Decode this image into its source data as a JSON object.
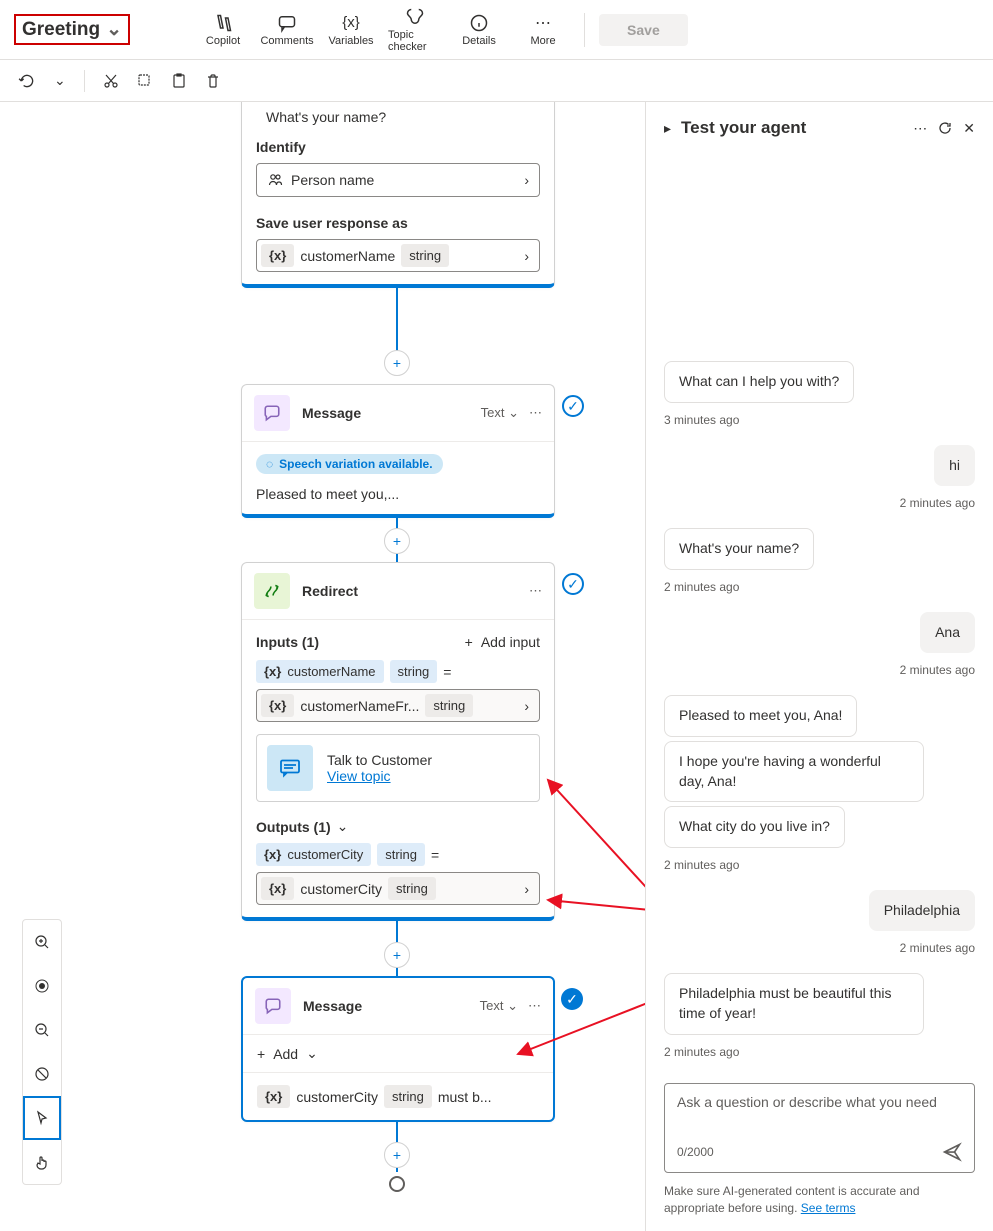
{
  "header": {
    "topic_title": "Greeting",
    "actions": [
      {
        "name": "copilot",
        "label": "Copilot"
      },
      {
        "name": "comments",
        "label": "Comments"
      },
      {
        "name": "variables",
        "label": "Variables"
      },
      {
        "name": "topic-checker",
        "label": "Topic checker"
      },
      {
        "name": "details",
        "label": "Details"
      },
      {
        "name": "more",
        "label": "More"
      }
    ],
    "save_label": "Save"
  },
  "canvas": {
    "card1": {
      "question_text": "What's your name?",
      "identify_label": "Identify",
      "identify_value": "Person name",
      "save_as_label": "Save user response as",
      "var_name": "customerName",
      "var_type": "string"
    },
    "card2": {
      "title": "Message",
      "type_label": "Text",
      "speech_pill": "Speech variation available.",
      "body_text": "Pleased to meet you,..."
    },
    "card3": {
      "title": "Redirect",
      "inputs_label": "Inputs (1)",
      "add_input_label": "Add input",
      "input_var": "customerName",
      "input_type": "string",
      "input_eq": "=",
      "input_val_var": "customerNameFr...",
      "input_val_type": "string",
      "talk_title": "Talk to Customer",
      "view_topic": "View topic",
      "outputs_label": "Outputs (1)",
      "output_var": "customerCity",
      "output_type": "string",
      "output_eq": "=",
      "output_val_var": "customerCity",
      "output_val_type": "string"
    },
    "card4": {
      "title": "Message",
      "type_label": "Text",
      "add_label": "Add",
      "var": "customerCity",
      "var_type": "string",
      "suffix": "must b..."
    }
  },
  "test_panel": {
    "title": "Test your agent",
    "messages": [
      {
        "role": "bot",
        "text": "What can I help you with?",
        "ts": "3 minutes ago"
      },
      {
        "role": "user",
        "text": "hi",
        "ts": "2 minutes ago"
      },
      {
        "role": "bot",
        "text": "What's your name?",
        "ts": "2 minutes ago"
      },
      {
        "role": "user",
        "text": "Ana",
        "ts": "2 minutes ago"
      },
      {
        "role": "bot",
        "text": "Pleased to meet you, Ana!",
        "ts": ""
      },
      {
        "role": "bot",
        "text": "I hope you're having a wonderful day, Ana!",
        "ts": ""
      },
      {
        "role": "bot",
        "text": "What city do you live in?",
        "ts": "2 minutes ago"
      },
      {
        "role": "user",
        "text": "Philadelphia",
        "ts": "2 minutes ago"
      },
      {
        "role": "bot",
        "text": "Philadelphia must be beautiful this time of year!",
        "ts": "2 minutes ago"
      }
    ],
    "composer_placeholder": "Ask a question or describe what you need",
    "char_count": "0/2000",
    "disclaimer": "Make sure AI-generated content is accurate and appropriate before using. ",
    "terms": "See terms"
  }
}
